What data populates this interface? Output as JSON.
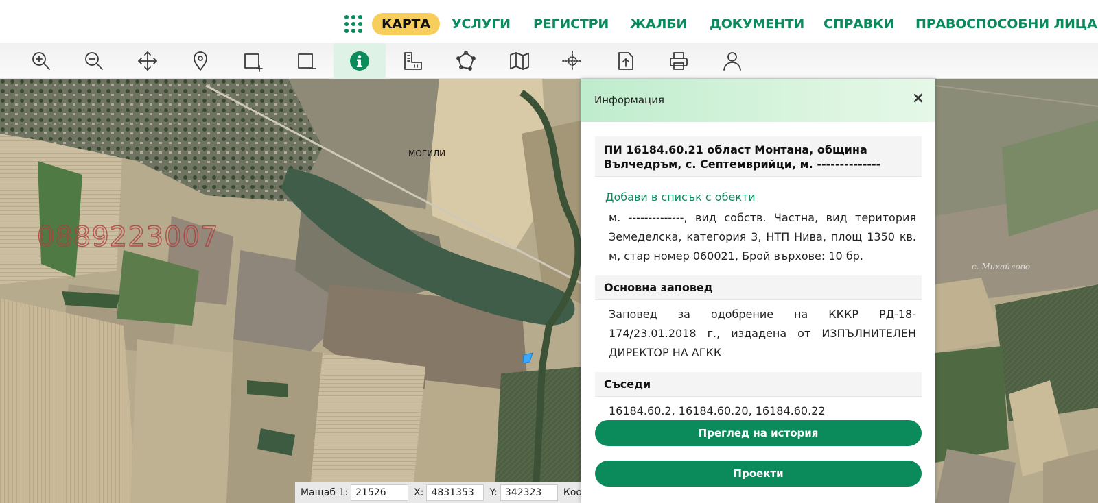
{
  "nav": {
    "items": [
      {
        "label": "КАРТА",
        "active": true
      },
      {
        "label": "УСЛУГИ",
        "active": false
      },
      {
        "label": "РЕГИСТРИ",
        "active": false
      },
      {
        "label": "ЖАЛБИ",
        "active": false
      },
      {
        "label": "ДОКУМЕНТИ",
        "active": false
      },
      {
        "label": "СПРАВКИ",
        "active": false
      },
      {
        "label": "ПРАВОСПОСОБНИ ЛИЦА",
        "active": false
      }
    ]
  },
  "toolbar": {
    "tools": [
      {
        "icon": "zoom-in-icon"
      },
      {
        "icon": "zoom-out-icon"
      },
      {
        "icon": "pan-icon"
      },
      {
        "icon": "location-pin-icon"
      },
      {
        "icon": "select-add-icon"
      },
      {
        "icon": "select-remove-icon"
      },
      {
        "icon": "info-icon",
        "active": true
      },
      {
        "icon": "measure-icon"
      },
      {
        "icon": "polygon-icon"
      },
      {
        "icon": "map-layers-icon"
      },
      {
        "icon": "crosshair-icon"
      },
      {
        "icon": "export-icon"
      },
      {
        "icon": "print-icon"
      },
      {
        "icon": "user-icon"
      }
    ]
  },
  "map": {
    "village_label": "МОГИЛИ",
    "watermark_phone": "0889223007",
    "village2_label": "с. Михайлово"
  },
  "statusbar": {
    "scale_label": "Мащаб 1:",
    "scale_value": "21526",
    "x_label": "X:",
    "x_value": "4831353",
    "y_label": "Y:",
    "y_value": "342323",
    "coord_label": "Коор"
  },
  "panel": {
    "title": "Информация",
    "close": "×",
    "parcel_title": "ПИ 16184.60.21 област Монтана, община Вълчедръм, с. Септемврийци, м. --------------",
    "add_link": "Добави в списък с обекти",
    "parcel_desc": "м. --------------, вид собств. Частна, вид територия Земеделска, категория 3, НТП Нива, площ 1350 кв. м, стар номер 060021, Брой върхове: 10 бр.",
    "order_heading": "Основна заповед",
    "order_text": "Заповед за одобрение на КККР РД-18-174/23.01.2018 г., издадена от ИЗПЪЛНИТЕЛЕН ДИРЕКТОР НА АГКК",
    "neighbors_heading": "Съседи",
    "neighbors_text": "16184.60.2, 16184.60.20, 16184.60.22",
    "history_button": "Преглед на история",
    "projects_button": "Проекти"
  },
  "colors": {
    "brand_green": "#0b8a5c",
    "active_tab": "#f7ce5c",
    "panel_header": "#c9f0d3"
  }
}
